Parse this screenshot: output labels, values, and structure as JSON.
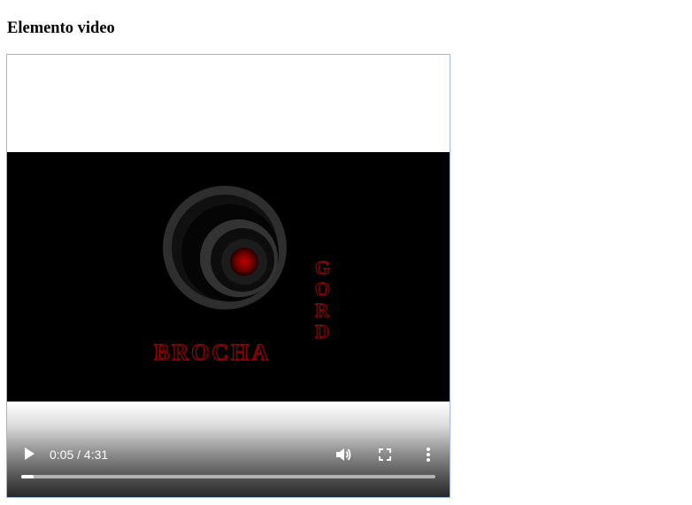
{
  "page": {
    "heading": "Elemento video"
  },
  "player": {
    "current_time": "0:05",
    "duration": "4:31",
    "time_display": "0:05 / 4:31",
    "progress_fraction": 0.03,
    "logo": {
      "word_horizontal": "BROCHA",
      "word_vertical": "GORD"
    }
  },
  "icons": {
    "play": "play-icon",
    "volume": "volume-icon",
    "fullscreen": "fullscreen-icon",
    "more": "more-vert-icon"
  },
  "colors": {
    "logo_red": "#8b0000",
    "border": "#9db7e9"
  }
}
